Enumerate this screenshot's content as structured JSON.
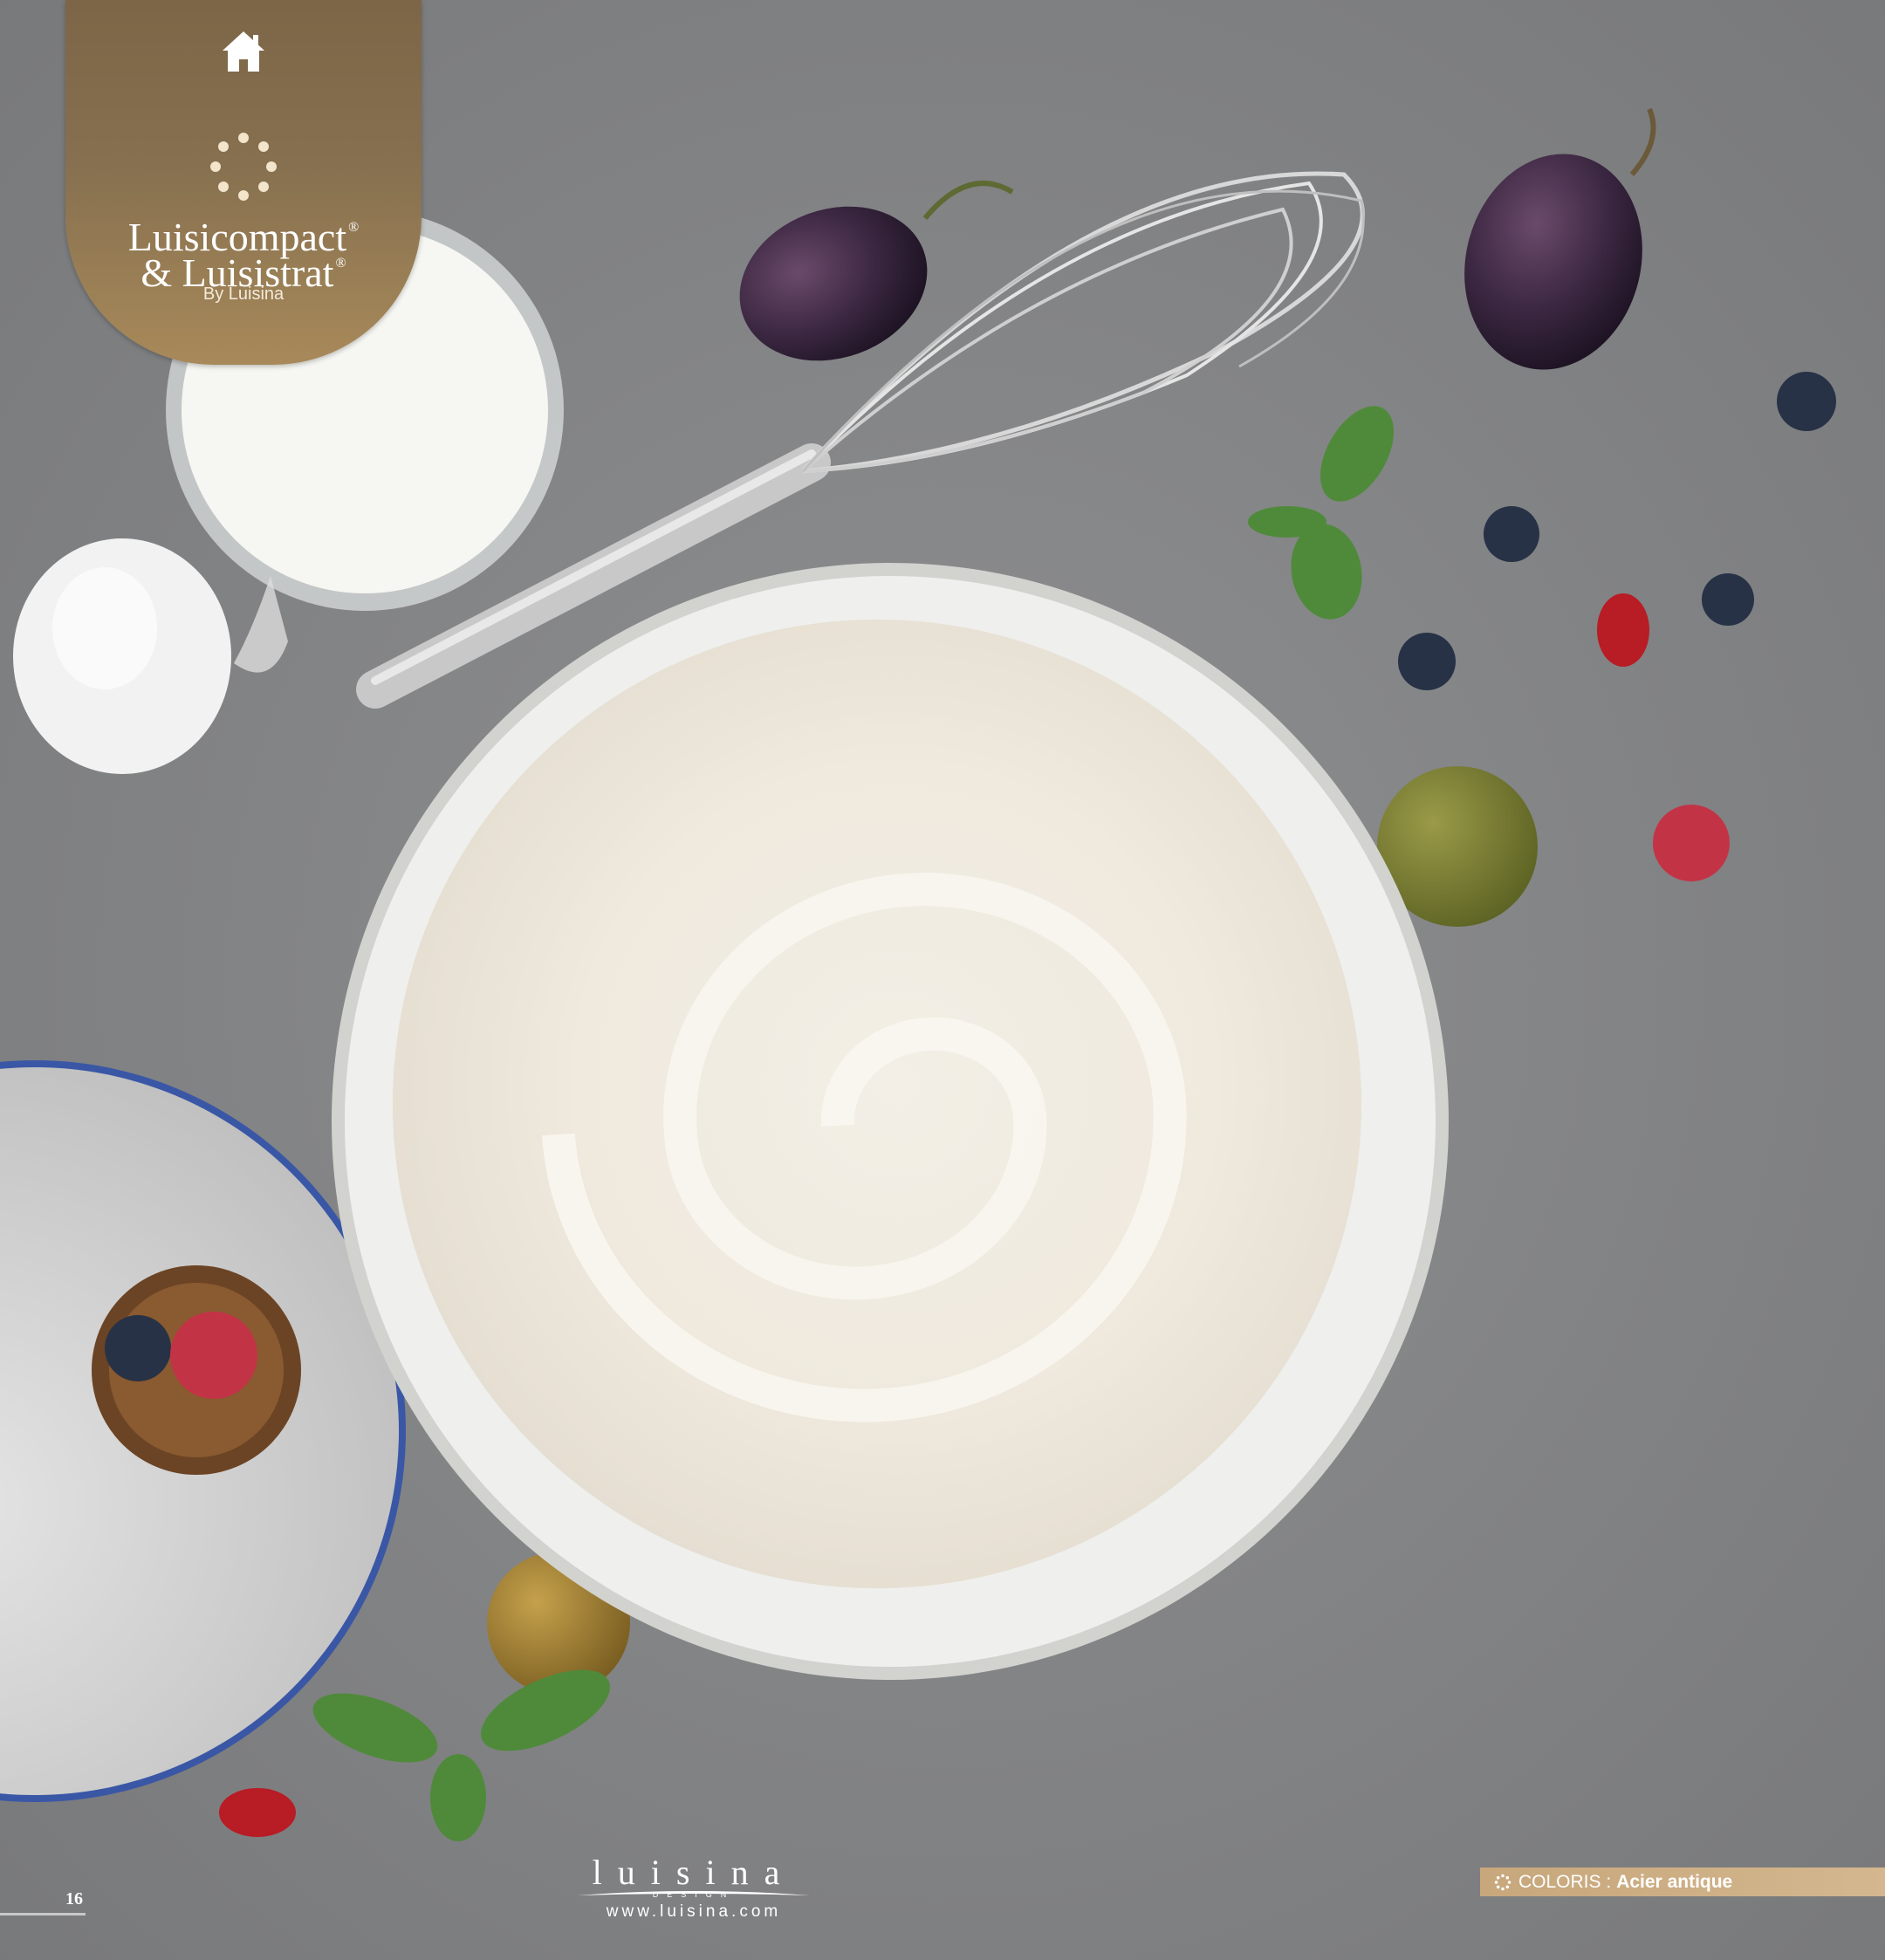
{
  "brand": {
    "line1": "Luisicompact",
    "line2": "& Luisistrat",
    "registered": "®",
    "by": "By Luisina"
  },
  "footer": {
    "page_number": "16",
    "logo_word": "luisina",
    "logo_design": "DESIGN",
    "logo_url": "www.luisina.com",
    "coloris_label": "COLORIS :",
    "coloris_value": "Acier antique"
  },
  "colors": {
    "tab_gold": "#86704f",
    "bar_gold": "#c9a97c",
    "surface_grey": "#8a8b8c"
  }
}
